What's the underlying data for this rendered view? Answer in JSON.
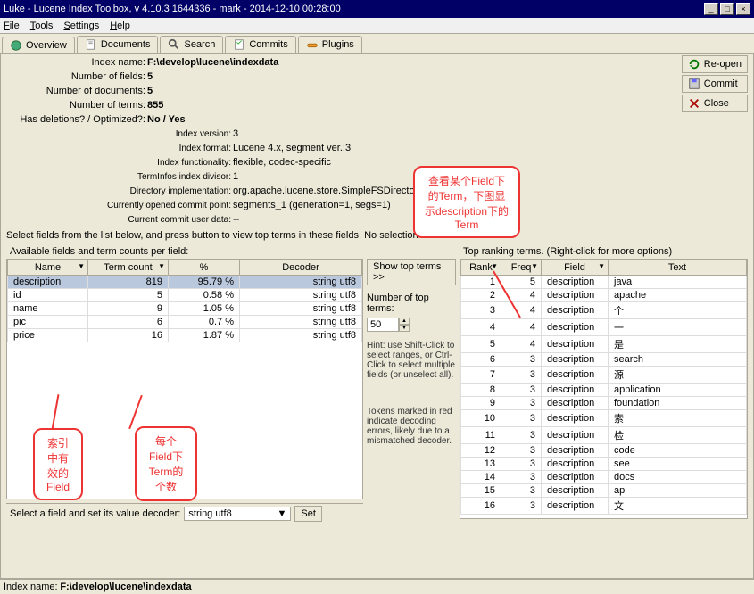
{
  "window": {
    "title": "Luke - Lucene Index Toolbox, v 4.10.3 1644336 - mark - 2014-12-10 00:28:00",
    "min": "_",
    "max": "□",
    "close": "×"
  },
  "menu": {
    "file": "File",
    "tools": "Tools",
    "settings": "Settings",
    "help": "Help"
  },
  "tabs": {
    "overview": "Overview",
    "documents": "Documents",
    "search": "Search",
    "commits": "Commits",
    "plugins": "Plugins"
  },
  "side": {
    "reopen": "Re-open",
    "commit": "Commit",
    "close": "Close"
  },
  "stats": {
    "indexname_lbl": "Index name:",
    "indexname_val": "F:\\develop\\lucene\\indexdata",
    "numfields_lbl": "Number of fields:",
    "numfields_val": "5",
    "numdocs_lbl": "Number of documents:",
    "numdocs_val": "5",
    "numterms_lbl": "Number of terms:",
    "numterms_val": "855",
    "del_lbl": "Has deletions? / Optimized?:",
    "del_val": "No / Yes",
    "ver_lbl": "Index version:",
    "ver_val": "3",
    "fmt_lbl": "Index format:",
    "fmt_val": "Lucene 4.x, segment ver.:3",
    "func_lbl": "Index functionality:",
    "func_val": "flexible, codec-specific",
    "tid_lbl": "TermInfos index divisor:",
    "tid_val": "1",
    "dir_lbl": "Directory implementation:",
    "dir_val": "org.apache.lucene.store.SimpleFSDirectory",
    "cp_lbl": "Currently opened commit point:",
    "cp_val": "segments_1 (generation=1, segs=1)",
    "cud_lbl": "Current commit user data:",
    "cud_val": "--"
  },
  "prompt": "Select fields from the list below, and press button to view top terms in these fields. No selection means all fields.",
  "avail_lbl": "Available fields and term counts per field:",
  "top_lbl": "Top ranking terms. (Right-click for more options)",
  "fields_hdr": {
    "name": "Name",
    "tc": "Term count",
    "pct": "%",
    "dec": "Decoder"
  },
  "fields": [
    {
      "name": "description",
      "tc": "819",
      "pct": "95.79 %",
      "dec": "string utf8"
    },
    {
      "name": "id",
      "tc": "5",
      "pct": "0.58 %",
      "dec": "string utf8"
    },
    {
      "name": "name",
      "tc": "9",
      "pct": "1.05 %",
      "dec": "string utf8"
    },
    {
      "name": "pic",
      "tc": "6",
      "pct": "0.7 %",
      "dec": "string utf8"
    },
    {
      "name": "price",
      "tc": "16",
      "pct": "1.87 %",
      "dec": "string utf8"
    }
  ],
  "mid": {
    "showbtn": "Show top terms >>",
    "numlbl": "Number of top terms:",
    "numval": "50",
    "hint1": "Hint: use Shift-Click to select ranges, or Ctrl-Click to select multiple fields (or unselect all).",
    "hint2": "Tokens marked in red indicate decoding errors, likely due to a mismatched decoder."
  },
  "terms_hdr": {
    "rank": "Rank",
    "freq": "Freq",
    "field": "Field",
    "text": "Text"
  },
  "terms": [
    {
      "r": "1",
      "f": "5",
      "fld": "description",
      "t": "java"
    },
    {
      "r": "2",
      "f": "4",
      "fld": "description",
      "t": "apache"
    },
    {
      "r": "3",
      "f": "4",
      "fld": "description",
      "t": "个"
    },
    {
      "r": "4",
      "f": "4",
      "fld": "description",
      "t": "一"
    },
    {
      "r": "5",
      "f": "4",
      "fld": "description",
      "t": "是"
    },
    {
      "r": "6",
      "f": "3",
      "fld": "description",
      "t": "search"
    },
    {
      "r": "7",
      "f": "3",
      "fld": "description",
      "t": "源"
    },
    {
      "r": "8",
      "f": "3",
      "fld": "description",
      "t": "application"
    },
    {
      "r": "9",
      "f": "3",
      "fld": "description",
      "t": "foundation"
    },
    {
      "r": "10",
      "f": "3",
      "fld": "description",
      "t": "索"
    },
    {
      "r": "11",
      "f": "3",
      "fld": "description",
      "t": "检"
    },
    {
      "r": "12",
      "f": "3",
      "fld": "description",
      "t": "code"
    },
    {
      "r": "13",
      "f": "3",
      "fld": "description",
      "t": "see"
    },
    {
      "r": "14",
      "f": "3",
      "fld": "description",
      "t": "docs"
    },
    {
      "r": "15",
      "f": "3",
      "fld": "description",
      "t": "api"
    },
    {
      "r": "16",
      "f": "3",
      "fld": "description",
      "t": "文"
    }
  ],
  "decoder": {
    "lbl": "Select a field and set its value decoder:",
    "val": "string utf8",
    "btn": "Set"
  },
  "status": {
    "idx_lbl": "Index name:",
    "idx_val": "F:\\develop\\lucene\\indexdata"
  },
  "callouts": {
    "top": "查看某个Field下的Term，下图显示description下的Term",
    "left": "索引中有效的Field",
    "mid": "每个Field下Term的个数"
  }
}
